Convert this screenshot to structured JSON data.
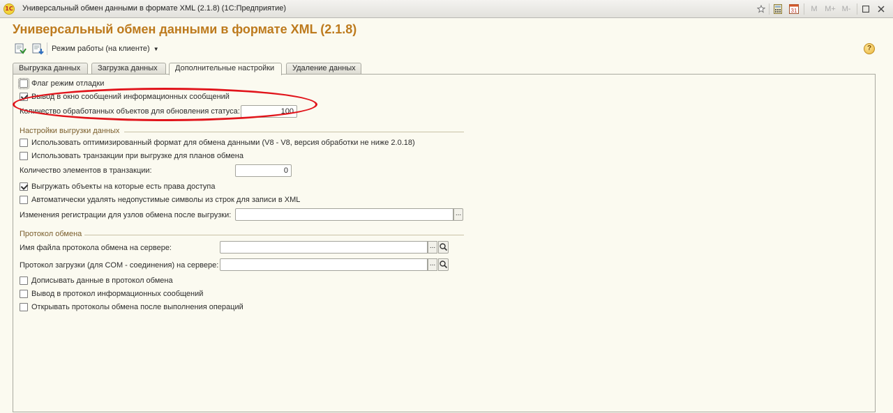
{
  "window": {
    "title": "Универсальный обмен данными в формате XML (2.1.8)  (1С:Предприятие)",
    "app_icon_text": "1С",
    "controls": [
      "M",
      "M+",
      "M-"
    ]
  },
  "form": {
    "title": "Универсальный обмен данными в формате XML (2.1.8)",
    "mode_button": "Режим работы (на клиенте)",
    "help_symbol": "?"
  },
  "tabs": [
    {
      "label": "Выгрузка данных",
      "active": false
    },
    {
      "label": "Загрузка данных",
      "active": false
    },
    {
      "label": "Дополнительные настройки",
      "active": true
    },
    {
      "label": "Удаление данных",
      "active": false
    }
  ],
  "general": {
    "debug_flag": {
      "label": "Флаг режим отладки",
      "checked": false
    },
    "info_messages": {
      "label": "Вывод в окно сообщений информационных сообщений",
      "checked": true
    },
    "objects_count_label": "Количество обработанных объектов для обновления статуса:",
    "objects_count_value": "100"
  },
  "export_settings": {
    "section_title": "Настройки выгрузки данных",
    "optimized_format": {
      "label": "Использовать оптимизированный формат для обмена данными (V8 - V8, версия обработки не ниже 2.0.18)",
      "checked": false
    },
    "use_transactions": {
      "label": "Использовать транзакции при выгрузке для планов обмена",
      "checked": false
    },
    "transaction_items_label": "Количество элементов в транзакции:",
    "transaction_items_value": "0",
    "access_rights": {
      "label": "Выгружать объекты на которые есть права доступа",
      "checked": true
    },
    "remove_invalid_chars": {
      "label": "Автоматически удалять недопустимые символы из строк для записи в XML",
      "checked": false
    },
    "registration_changes_label": "Изменения регистрации для узлов обмена после выгрузки:",
    "registration_changes_value": ""
  },
  "protocol": {
    "section_title": "Протокол обмена",
    "server_file_label": "Имя файла протокола обмена на сервере:",
    "server_file_value": "",
    "com_protocol_label": "Протокол загрузки (для COM - соединения) на сервере:",
    "com_protocol_value": "",
    "append_data": {
      "label": "Дописывать данные в протокол обмена",
      "checked": false
    },
    "info_to_protocol": {
      "label": "Вывод в протокол информационных сообщений",
      "checked": false
    },
    "open_protocols": {
      "label": "Открывать протоколы обмена после выполнения операций",
      "checked": false
    }
  },
  "buttons": {
    "ellipsis": "...",
    "search_icon": "magnifier-icon"
  },
  "colors": {
    "form_title": "#bd7a1d",
    "highlight": "#e1141b",
    "background": "#fbfaf0"
  }
}
